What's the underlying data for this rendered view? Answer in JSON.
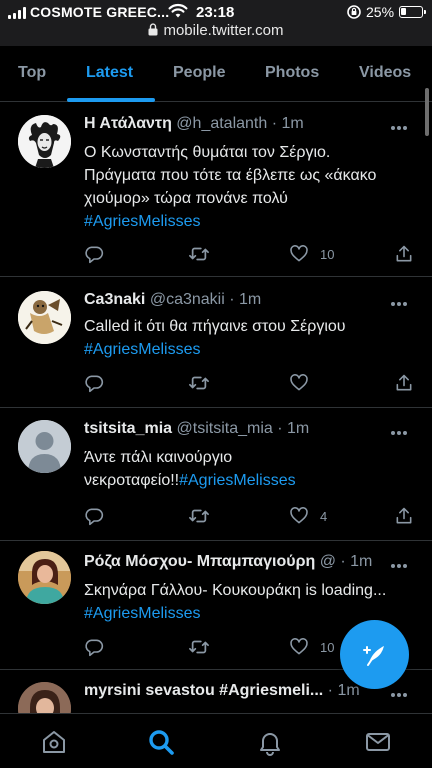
{
  "status_bar": {
    "carrier": "COSMOTE GREEC...",
    "time": "23:18",
    "battery": "25%",
    "url": "mobile.twitter.com"
  },
  "tabs": [
    {
      "label": "Top",
      "active": false
    },
    {
      "label": "Latest",
      "active": true
    },
    {
      "label": "People",
      "active": false
    },
    {
      "label": "Photos",
      "active": false
    },
    {
      "label": "Videos",
      "active": false
    }
  ],
  "tweets": [
    {
      "name": "Η Ατάλαντη",
      "handle": "@h_atalanth",
      "sep": " · ",
      "time": "1m",
      "lines": [
        "Ο Κωνσταντής θυμάται τον Σέργιο.",
        "Πράγματα που τότε τα έβλεπε ως «άκακο",
        "χιούμορ» τώρα πονάνε πολύ"
      ],
      "hashtag": "#AgriesMelisses",
      "likes": "10",
      "avatar_icon": "medusa-avatar"
    },
    {
      "name": "Ca3naki",
      "handle": "@ca3nakii",
      "sep": " · ",
      "time": "1m",
      "lines": [
        "Called it ότι θα πήγαινε στου Σέργιου"
      ],
      "hashtag": "#AgriesMelisses",
      "likes": "",
      "avatar_icon": "sketch-avatar"
    },
    {
      "name": "tsitsita_mia",
      "handle": "@tsitsita_mia",
      "sep": " · ",
      "time": "1m",
      "lines": [
        "Άντε πάλι καινούργιο"
      ],
      "inline_prefix": "νεκροταφείο!!",
      "hashtag": "#AgriesMelisses",
      "likes": "4",
      "avatar_icon": "default-avatar"
    },
    {
      "name": "Ρόζα Μόσχου- Μπαμπαγιούρη",
      "handle": "@",
      "sep": " · ",
      "time": "1m",
      "lines": [
        "Σκηνάρα Γάλλου- Κουκουράκη is loading..."
      ],
      "hashtag": "#AgriesMelisses",
      "likes": "10",
      "avatar_icon": "photo-avatar"
    },
    {
      "name": "myrsini sevastou #Agriesmeli...",
      "sep": " · ",
      "time": "1m",
      "avatar_icon": "photo-avatar"
    }
  ],
  "colors": {
    "accent": "#1d9bf0",
    "background": "#000000",
    "muted": "#8b98a5",
    "divider": "#2f3336"
  },
  "nav": [
    "home-icon",
    "search-icon",
    "notifications-icon",
    "messages-icon"
  ]
}
